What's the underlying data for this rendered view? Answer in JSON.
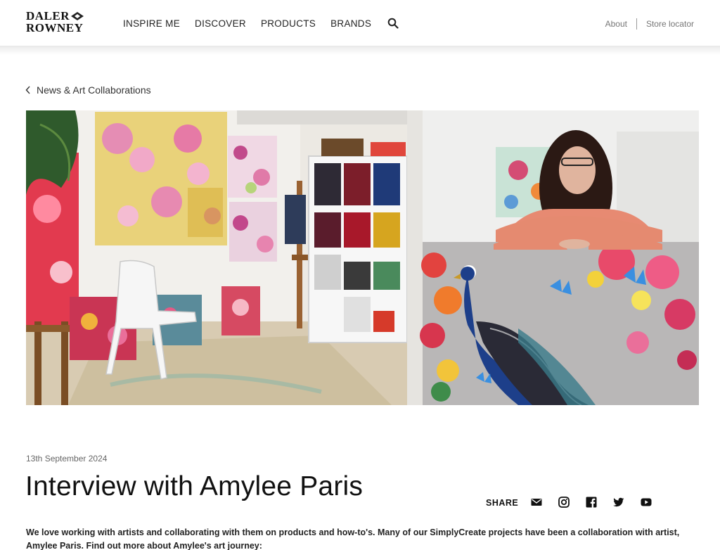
{
  "brand": {
    "line1": "DALER",
    "line2": "ROWNEY"
  },
  "nav": {
    "items": [
      "INSPIRE ME",
      "DISCOVER",
      "PRODUCTS",
      "BRANDS"
    ],
    "search_icon": "search-icon"
  },
  "top_links": {
    "about": "About",
    "store_locator": "Store locator"
  },
  "breadcrumb": {
    "label": "News & Art Collaborations",
    "icon": "chevron-left-icon"
  },
  "article": {
    "date": "13th September 2024",
    "title": "Interview with Amylee Paris",
    "intro": "We love working with artists and collaborating with them on products and how-to's. Many of our SimplyCreate projects have been a collaboration with artist, Amylee Paris. Find out more about Amylee's art journey:"
  },
  "share": {
    "label": "SHARE",
    "icons": [
      "email-icon",
      "instagram-icon",
      "facebook-icon",
      "twitter-icon",
      "youtube-icon"
    ]
  },
  "colors": {
    "text": "#111111",
    "muted": "#777777",
    "background": "#ffffff"
  }
}
